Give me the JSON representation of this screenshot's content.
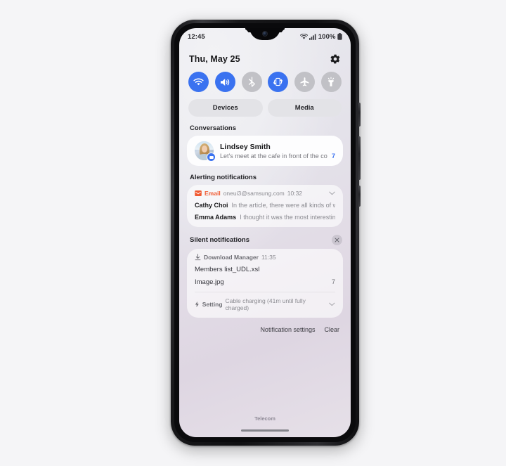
{
  "statusbar": {
    "time": "12:45",
    "battery_pct": "100%",
    "icons": [
      "wifi-icon",
      "signal-icon",
      "battery-icon"
    ]
  },
  "quick_panel": {
    "date": "Thu, May 25",
    "settings_icon": "gear-icon",
    "toggles": [
      {
        "name": "wifi",
        "icon": "wifi-icon",
        "state": "on"
      },
      {
        "name": "sound",
        "icon": "volume-icon",
        "state": "on"
      },
      {
        "name": "bluetooth",
        "icon": "bluetooth-icon",
        "state": "off"
      },
      {
        "name": "auto-rotate",
        "icon": "auto-rotate-icon",
        "state": "on"
      },
      {
        "name": "airplane",
        "icon": "airplane-icon",
        "state": "off"
      },
      {
        "name": "flashlight",
        "icon": "flashlight-icon",
        "state": "off"
      }
    ],
    "devices_label": "Devices",
    "media_label": "Media"
  },
  "conversations": {
    "section_label": "Conversations",
    "item": {
      "name": "Lindsey Smith",
      "message": "Let's meet at the cafe in front of the coff...",
      "count": "7",
      "avatar": "contact-photo",
      "badge_icon": "message-icon"
    }
  },
  "alerting": {
    "section_label": "Alerting notifications",
    "app_name": "Email",
    "app_icon": "email-icon",
    "account": "oneui3@samsung.com",
    "time": "10:32",
    "expand_icon": "chevron-down-icon",
    "messages": [
      {
        "sender": "Cathy Choi",
        "preview": "In the article, there were all kinds of wond..."
      },
      {
        "sender": "Emma Adams",
        "preview": "I thought it was the most interesting th..."
      }
    ]
  },
  "silent": {
    "section_label": "Silent notifications",
    "close_icon": "close-icon",
    "download": {
      "app_name": "Download Manager",
      "app_icon": "download-icon",
      "time": "11:35",
      "files": [
        {
          "name": "Members list_UDL.xsl",
          "count": ""
        },
        {
          "name": "Image.jpg",
          "count": "7"
        }
      ]
    },
    "setting": {
      "app_name": "Setting",
      "app_icon": "charging-bolt-icon",
      "text": "Cable charging (41m until fully charged)",
      "expand_icon": "chevron-down-icon"
    }
  },
  "footer": {
    "notification_settings_label": "Notification settings",
    "clear_label": "Clear"
  },
  "lockscreen": {
    "carrier": "Telecom"
  },
  "colors": {
    "accent": "#3a72f0",
    "toggle_off": "#c1c1c6",
    "email_accent": "#f05a32"
  }
}
